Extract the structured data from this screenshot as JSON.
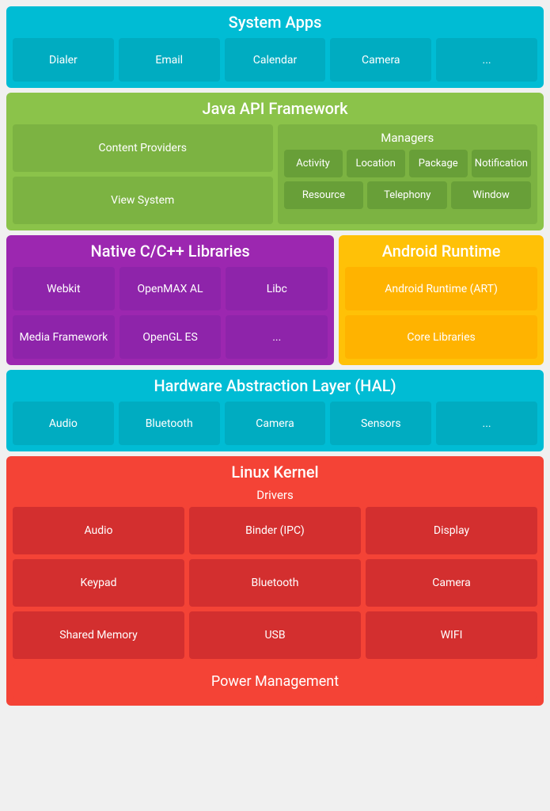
{
  "system_apps": {
    "title": "System Apps",
    "items": [
      "Dialer",
      "Email",
      "Calendar",
      "Camera",
      "..."
    ]
  },
  "java_api": {
    "title": "Java API Framework",
    "content_providers": "Content Providers",
    "view_system": "View System",
    "managers_title": "Managers",
    "managers_row1": [
      "Activity",
      "Location",
      "Package",
      "Notification"
    ],
    "managers_row2": [
      "Resource",
      "Telephony",
      "Window"
    ]
  },
  "native": {
    "title": "Native C/C++ Libraries",
    "items": [
      "Webkit",
      "OpenMAX AL",
      "Libc",
      "Media Framework",
      "OpenGL ES",
      "..."
    ]
  },
  "android_runtime": {
    "title": "Android Runtime",
    "items": [
      "Android Runtime (ART)",
      "Core Libraries"
    ]
  },
  "hal": {
    "title": "Hardware Abstraction Layer (HAL)",
    "items": [
      "Audio",
      "Bluetooth",
      "Camera",
      "Sensors",
      "..."
    ]
  },
  "linux_kernel": {
    "title": "Linux Kernel",
    "drivers_title": "Drivers",
    "drivers": [
      "Audio",
      "Binder (IPC)",
      "Display",
      "Keypad",
      "Bluetooth",
      "Camera",
      "Shared Memory",
      "USB",
      "WIFI"
    ],
    "power_management": "Power Management"
  }
}
